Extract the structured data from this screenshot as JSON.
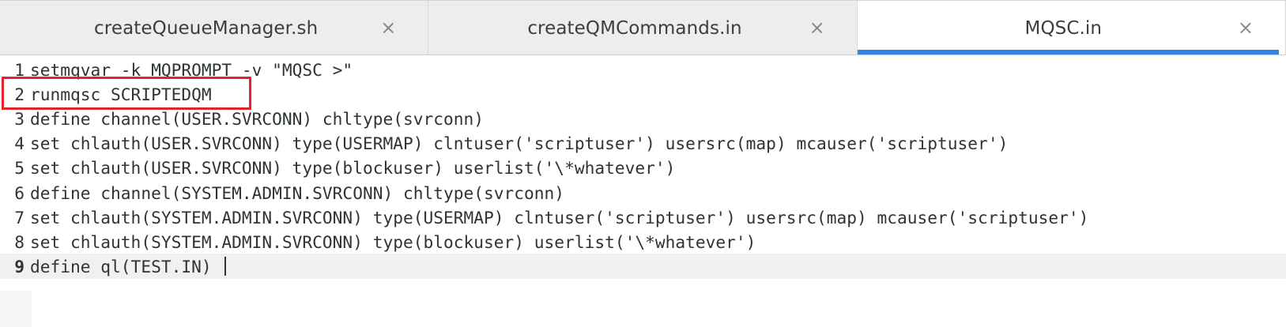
{
  "tabs": [
    {
      "label": "createQueueManager.sh",
      "close": "×",
      "active": false
    },
    {
      "label": "createQMCommands.in",
      "close": "×",
      "active": false
    },
    {
      "label": "MQSC.in",
      "close": "×",
      "active": true
    }
  ],
  "editor": {
    "current_line": 9,
    "lines": [
      {
        "num": "1",
        "text": "setmqvar -k MQPROMPT -v \"MQSC >\""
      },
      {
        "num": "2",
        "text": "runmqsc SCRIPTEDQM"
      },
      {
        "num": "3",
        "text": "define channel(USER.SVRCONN) chltype(svrconn)"
      },
      {
        "num": "4",
        "text": "set chlauth(USER.SVRCONN) type(USERMAP) clntuser('scriptuser') usersrc(map) mcauser('scriptuser')"
      },
      {
        "num": "5",
        "text": "set chlauth(USER.SVRCONN) type(blockuser) userlist('\\*whatever')"
      },
      {
        "num": "6",
        "text": "define channel(SYSTEM.ADMIN.SVRCONN) chltype(svrconn)"
      },
      {
        "num": "7",
        "text": "set chlauth(SYSTEM.ADMIN.SVRCONN) type(USERMAP) clntuser('scriptuser') usersrc(map) mcauser('scriptuser')"
      },
      {
        "num": "8",
        "text": "set chlauth(SYSTEM.ADMIN.SVRCONN) type(blockuser) userlist('\\*whatever')"
      },
      {
        "num": "9",
        "text": "define ql(TEST.IN) "
      }
    ]
  },
  "colors": {
    "accent": "#3584e4",
    "highlight_box": "#e0242a"
  }
}
